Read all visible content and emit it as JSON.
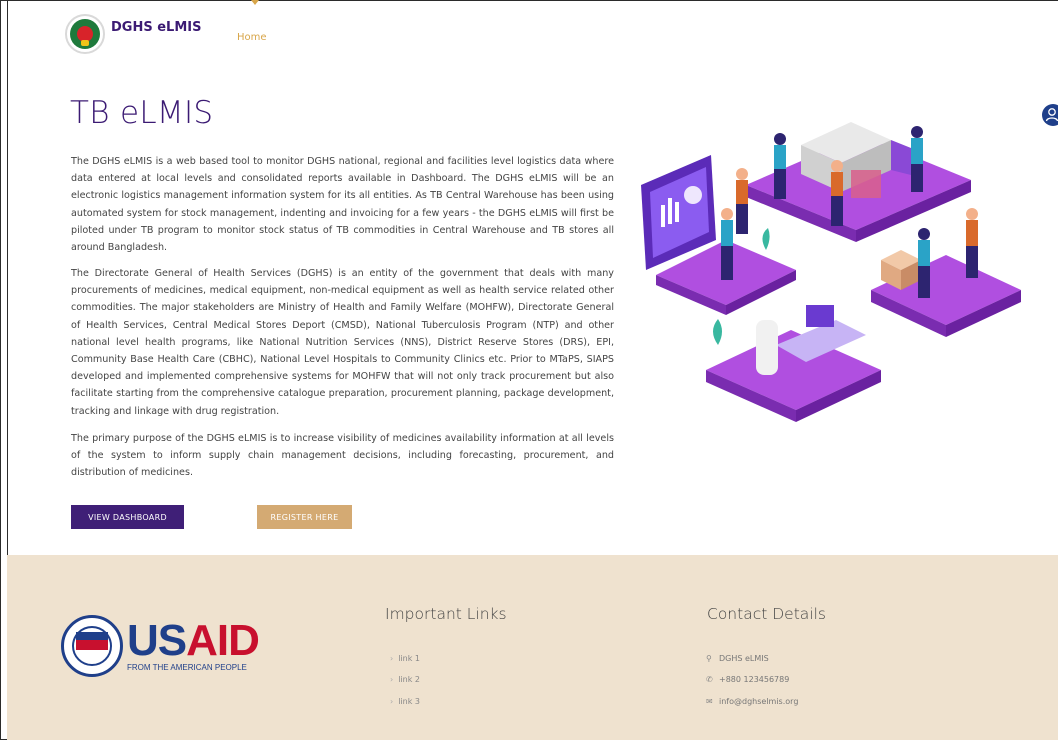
{
  "header": {
    "brand": "DGHS eLMIS",
    "nav": {
      "home_label": "Home"
    }
  },
  "main": {
    "title": "TB eLMIS",
    "paragraphs": [
      "The DGHS eLMIS is a web based tool to monitor DGHS national, regional and facilities level logistics data where data entered at local levels and consolidated reports available in Dashboard. The DGHS eLMIS will be an electronic logistics management information system for its all entities. As TB Central Warehouse has been using automated system for stock management, indenting and invoicing for a few years - the DGHS eLMIS will first be piloted under TB program to monitor stock status of TB commodities in Central Warehouse and TB stores all around Bangladesh.",
      "The Directorate General of Health Services (DGHS) is an entity of the government that deals with many procurements of medicines, medical equipment, non-medical equipment as well as health service related other commodities. The major stakeholders are Ministry of Health and Family Welfare (MOHFW), Directorate General of Health Services, Central Medical Stores Deport (CMSD), National Tuberculosis Program (NTP) and other national level health programs, like National Nutrition Services (NNS), District Reserve Stores (DRS), EPI, Community Base Health Care (CBHC), National Level Hospitals to Community Clinics etc. Prior to MTaPS, SIAPS developed and implemented comprehensive systems for MOHFW that will not only track procurement but also facilitate starting from the comprehensive catalogue preparation, procurement planning, package development, tracking and linkage with drug registration.",
      "The primary purpose of the DGHS eLMIS is to increase visibility of medicines availability information at all levels of the system to inform supply chain management decisions, including forecasting, procurement, and distribution of medicines."
    ],
    "buttons": {
      "dashboard": "VIEW DASHBOARD",
      "register": "REGISTER HERE"
    }
  },
  "footer": {
    "usaid": {
      "word": "USAID",
      "tagline": "FROM THE AMERICAN PEOPLE"
    },
    "links_title": "Important Links",
    "links": [
      "link 1",
      "link 2",
      "link 3"
    ],
    "contact_title": "Contact Details",
    "contact": {
      "name": "DGHS eLMIS",
      "phone": "+880 123456789",
      "email": "info@dghselmis.org"
    }
  },
  "colors": {
    "brand_purple": "#3f1f77",
    "accent_gold": "#d4aa73",
    "footer_bg": "#efe2cf"
  },
  "icons": {
    "user": "user-icon",
    "chevron": "chevron-right-icon",
    "location": "location-pin-icon",
    "phone": "phone-icon",
    "email": "email-icon"
  }
}
